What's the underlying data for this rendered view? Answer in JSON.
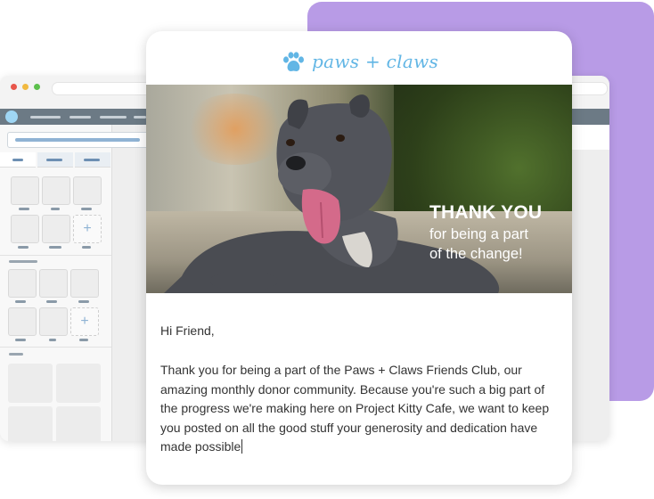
{
  "brand": {
    "name": "paws + claws",
    "logo_icon": "paw-icon",
    "color": "#62b6e5"
  },
  "hero": {
    "title": "THANK YOU",
    "subtitle_line1": "for being a part",
    "subtitle_line2": "of the change!"
  },
  "email": {
    "greeting": "Hi Friend,",
    "body": "Thank you for being a part of the Paws + Claws Friends Club, our amazing monthly donor community. Because you're such a big part of the progress we're making here on Project Kitty Cafe, we want to keep you posted on all the good stuff your generosity and dedication have made possible"
  },
  "editor": {
    "add_block_symbol": "+"
  },
  "colors": {
    "accent_purple": "#b89be6",
    "app_header": "#6c7a85",
    "text": "#333333"
  }
}
